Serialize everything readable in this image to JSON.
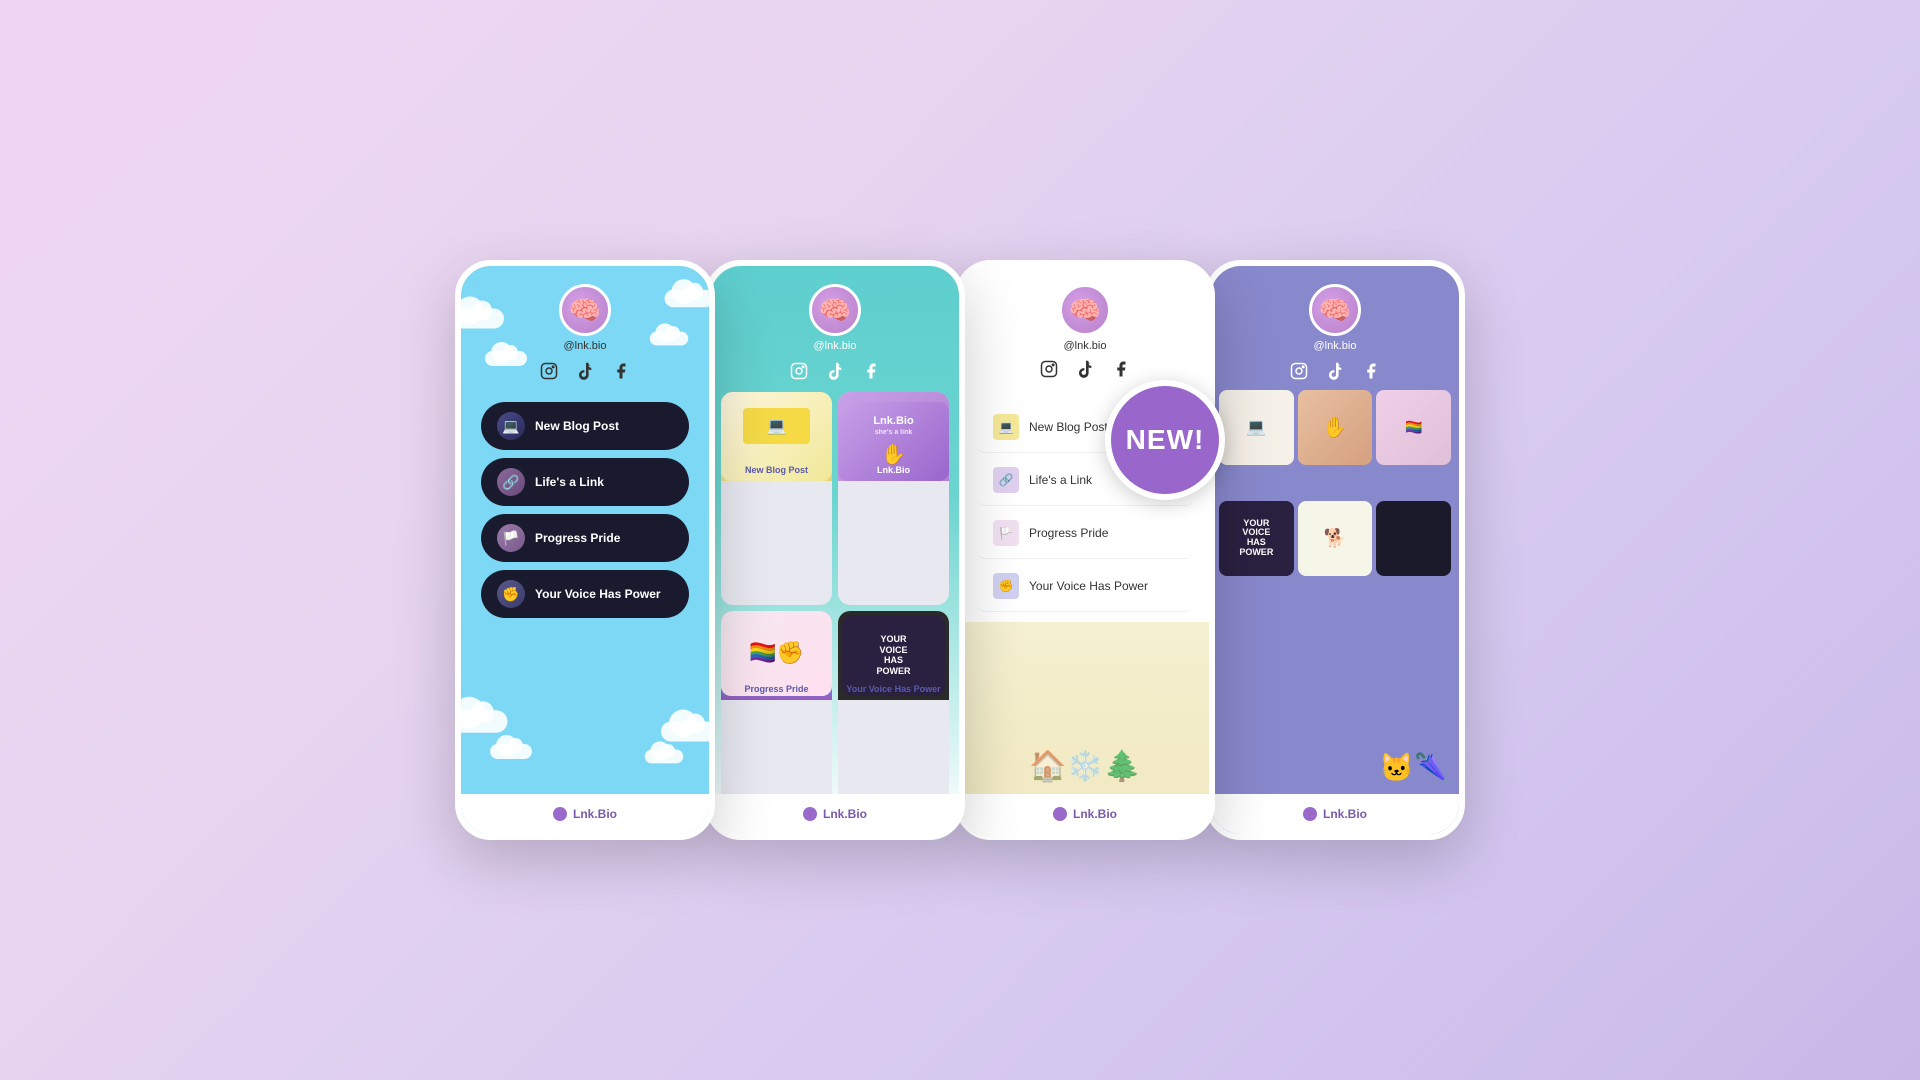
{
  "page": {
    "background": "lavender gradient",
    "new_badge": "NEW!"
  },
  "phones": [
    {
      "id": "phone-1",
      "theme": "sky-blue-clouds",
      "username": "@lnk.bio",
      "links": [
        {
          "label": "New Blog Post",
          "thumb": "💻"
        },
        {
          "label": "Life's a Link",
          "thumb": "🔗"
        },
        {
          "label": "Progress Pride",
          "thumb": "🏳️"
        },
        {
          "label": "Your Voice Has Power",
          "thumb": "✊"
        }
      ],
      "footer": "Lnk.Bio"
    },
    {
      "id": "phone-2",
      "theme": "teal-grid",
      "username": "@lnk.bio",
      "grid_items": [
        {
          "label": "New Blog Post",
          "type": "computer"
        },
        {
          "label": "Lnk.Bio",
          "type": "lnkbio"
        },
        {
          "label": "Progress Pride",
          "type": "pride"
        },
        {
          "label": "Your Voice Has Power",
          "type": "voice"
        }
      ],
      "footer": "Lnk.Bio"
    },
    {
      "id": "phone-3",
      "theme": "light-list",
      "username": "@lnk.bio",
      "links": [
        {
          "label": "New Blog Post",
          "thumb": "💻"
        },
        {
          "label": "Life's a Link",
          "thumb": "🔗"
        },
        {
          "label": "Progress Pride",
          "thumb": "🏳️"
        },
        {
          "label": "Your Voice Has Power",
          "thumb": "✊"
        }
      ],
      "footer": "Lnk.Bio"
    },
    {
      "id": "phone-4",
      "theme": "blue-mosaic",
      "username": "@lnk.bio",
      "footer": "Lnk.Bio"
    }
  ],
  "social_icons": {
    "instagram": "📷",
    "tiktok": "🎵",
    "facebook": "f"
  },
  "footer_label": "Lnk.Bio"
}
